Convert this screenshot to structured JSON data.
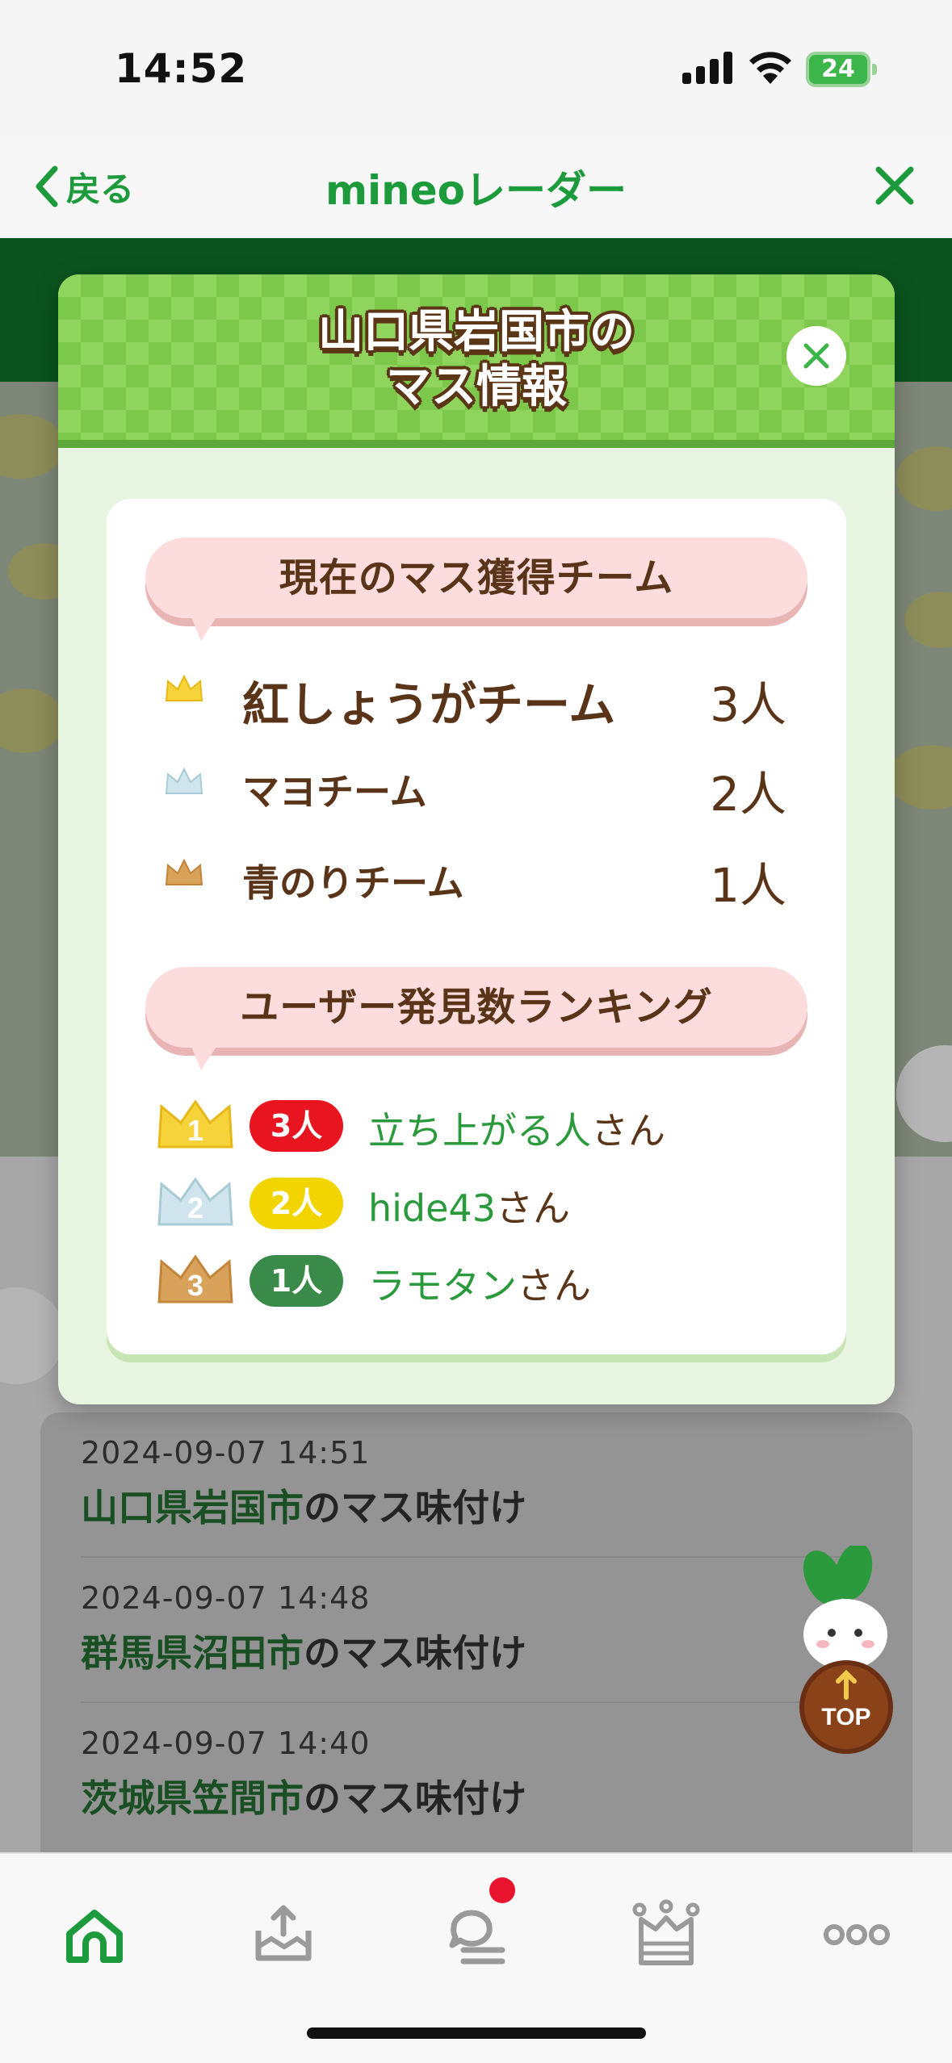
{
  "status_bar": {
    "time": "14:52",
    "battery": "24"
  },
  "nav": {
    "back_label": "戻る",
    "title": "mineoレーダー"
  },
  "background": {
    "log_items": [
      {
        "date": "2024-09-07 14:51",
        "place": "山口県岩国市",
        "action": "のマス味付け"
      },
      {
        "date": "2024-09-07 14:48",
        "place": "群馬県沼田市",
        "action": "のマス味付け"
      },
      {
        "date": "2024-09-07 14:40",
        "place": "茨城県笠間市",
        "action": "のマス味付け"
      }
    ],
    "top_button_label": "TOP"
  },
  "modal": {
    "title_line1": "山口県岩国市の",
    "title_line2": "マス情報",
    "current_team_heading": "現在のマス獲得チーム",
    "teams": [
      {
        "crown": "gold-crown-icon",
        "name": "紅しょうがチーム",
        "count": "3人"
      },
      {
        "crown": "silver-crown-icon",
        "name": "マヨチーム",
        "count": "2人"
      },
      {
        "crown": "bronze-crown-icon",
        "name": "青のりチーム",
        "count": "1人"
      }
    ],
    "ranking_heading": "ユーザー発見数ランキング",
    "ranking": [
      {
        "rank": "1",
        "count": "3人",
        "user": "立ち上がる人",
        "suffix": "さん",
        "badge_color": "#e8141f"
      },
      {
        "rank": "2",
        "count": "2人",
        "user": "hide43",
        "suffix": "さん",
        "badge_color": "#f2d400"
      },
      {
        "rank": "3",
        "count": "1人",
        "user": "ラモタン",
        "suffix": "さん",
        "badge_color": "#3a8a4a"
      }
    ]
  },
  "colors": {
    "brand_green": "#1d9a3b",
    "text_brown": "#5a3418",
    "bubble_pink": "#fcdcdc",
    "notification_red": "#e8142e"
  },
  "tab_bar": {
    "tabs": [
      "home-icon",
      "upload-icon",
      "chat-icon",
      "ranking-icon",
      "more-icon"
    ]
  }
}
